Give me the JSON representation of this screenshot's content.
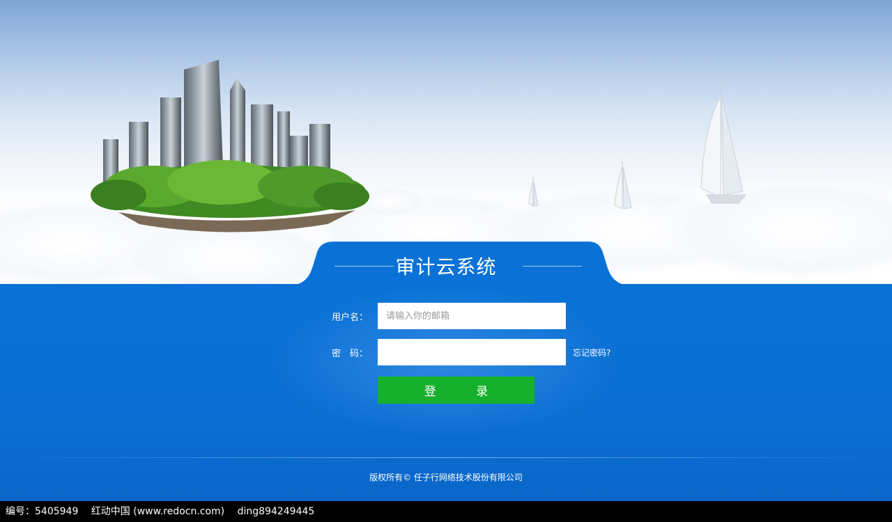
{
  "login": {
    "title": "审计云系统",
    "username_label": "用户名：",
    "username_placeholder": "请输入你的邮箱",
    "password_label": "密　码：",
    "forgot_link": "忘记密码?",
    "login_button": "登 录"
  },
  "footer": {
    "copyright": "版权所有© 任子行网络技术股份有限公司"
  },
  "watermark": {
    "id_text": "编号：5405949",
    "site_text": "红动中国 (www.redocn.com)",
    "author_text": "ding894249445"
  },
  "colors": {
    "primary_blue": "#0a72d6",
    "login_green": "#17b02d"
  }
}
